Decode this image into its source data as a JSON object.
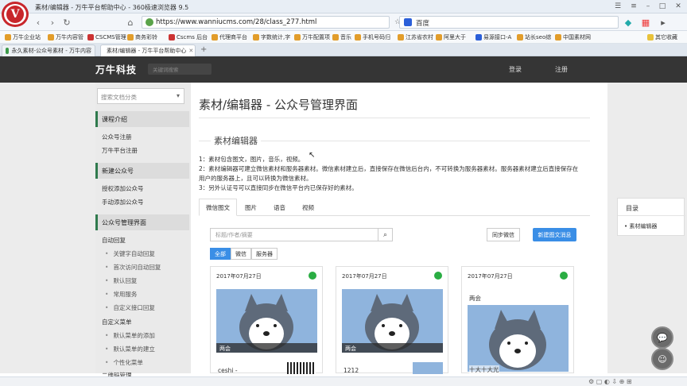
{
  "browser": {
    "window_title": "素材/编辑器 - 万牛平台帮助中心 - 360极速浏览器 9.5",
    "url": "https://www.wanniucms.com/28/class_277.html",
    "search_engine": "百度",
    "bookmarks": [
      "万牛企业站",
      "万牛内容管",
      "CSCMS管理",
      "商务彩铃",
      "Cscms 后台",
      "代理商平台",
      "字数统计,字",
      "万牛配置项",
      "音乐",
      "手机号码归",
      "江苏省农村",
      "阿里大于",
      "易源接口-A",
      "站长seo综",
      "中国素材网",
      "其它收藏"
    ],
    "tabs": [
      "永久素材-公众号素材 - 万牛内容",
      "素材/编辑器 - 万牛平台帮助中心"
    ]
  },
  "site": {
    "brand": "万牛科技",
    "search_placeholder": "关键词搜索",
    "login": "登录",
    "register": "注册"
  },
  "sidebar": {
    "select_placeholder": "搜索文档分类",
    "sections": [
      {
        "title": "课程介绍",
        "items": [
          "公众号注册",
          "万牛平台注册"
        ]
      },
      {
        "title": "新建公众号",
        "items": [
          "授权添加公众号",
          "手动添加公众号"
        ]
      },
      {
        "title": "公众号管理界面",
        "items": [
          "自动回复"
        ],
        "subitems": [
          "关键字自动回复",
          "首次访问自动回复",
          "默认回复",
          "常用服务",
          "自定义接口回复"
        ]
      },
      {
        "title": "",
        "items": [
          "自定义菜单"
        ],
        "subitems": [
          "默认菜单的添加",
          "默认菜单的建立",
          "个性化菜单"
        ]
      }
    ],
    "cut_item": "二维码管理"
  },
  "main": {
    "page_title": "素材/编辑器 - 公众号管理界面",
    "section_title": "素材编辑器",
    "desc": [
      "1：素材包含图文，图片，音乐，视频。",
      "2：素材编辑器可建立微信素材和服务器素材。微信素材建立后，直接保存在微信后台内，不可转换为服务器素材。服务器素材建立后直接保存在",
      "用户的服务器上，且可以转换为微信素材。",
      "3：另外认证号可以直接同步在微信平台内已保存好的素材。"
    ],
    "tabs": [
      "微信图文",
      "图片",
      "语音",
      "视频"
    ],
    "keyword_placeholder": "标题/作者/摘要",
    "sync_button": "同步微信",
    "new_button": "新建图文消息",
    "filters": [
      "全部",
      "微信",
      "服务器"
    ],
    "cards": [
      {
        "date": "2017年07月27日",
        "caption": "两会",
        "name": "ceshi -"
      },
      {
        "date": "2017年07月27日",
        "caption": "两会",
        "name": "1212"
      },
      {
        "date": "2017年07月27日",
        "caption": "两会",
        "name": "十大十大光"
      }
    ]
  },
  "toc": {
    "title": "目录",
    "item": "素材编辑器"
  },
  "colors": {
    "accent": "#3a8ee6",
    "header": "#353535",
    "sidebar_marker": "#2f7a4d",
    "wechat": "#2aad43"
  }
}
